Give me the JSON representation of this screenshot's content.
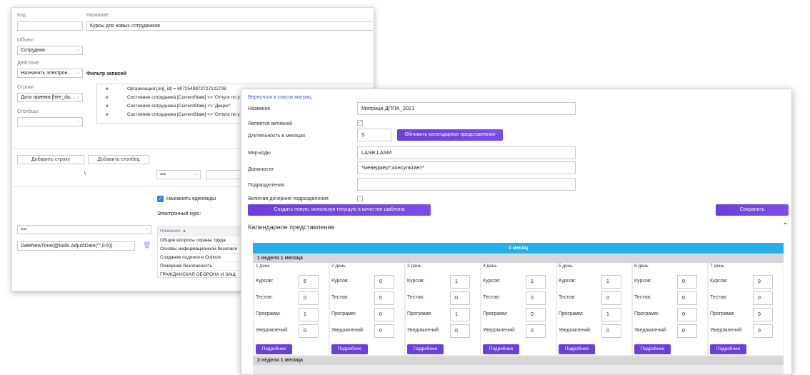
{
  "back": {
    "code_label": "Код",
    "code_value": "",
    "name_label": "Название",
    "name_value": "Курсы для новых сотрудников",
    "object_label": "Объект",
    "object_value": "Сотрудник",
    "action_label": "Действие",
    "action_value": "Назначить электрон...",
    "filter_label": "Фильтр записей",
    "rows_label": "Строки",
    "rows_value": "Дата приема [hire_da...",
    "columns_label": "Столбцы",
    "columns_value": "",
    "filters": [
      {
        "op": "и",
        "cond": "Организация [org_id]  =  6072549872727122738"
      },
      {
        "op": "и",
        "cond": "Состояние сотрудника [CurrentState]  <>  'Отпуск по у"
      },
      {
        "op": "и",
        "cond": "Состояние сотрудника [CurrentState]  <>  'Декрет'"
      },
      {
        "op": "и",
        "cond": "Состояние сотрудника [CurrentState]  <>  'Отпуск по у"
      }
    ],
    "add_row_label": "Добавить строку",
    "add_column_label": "Добавить столбец",
    "backslash": "\\",
    "eq_value": "==",
    "assign_once_label": "Назначить единожды",
    "ecourse_label": "Электронный курс:",
    "gte_value": ">=",
    "formula_value": "DateNewTime(@tools.AdjustDate(\"\",0-5))",
    "course_header": "Название ▲",
    "courses": [
      "Общие вопросы охраны труда",
      "Основы информационной безопасн",
      "Создание подписи в Outlook",
      "Пожарная безопасность",
      "ГРАЖДАНСКАЯ ОБОРОНА И ЗАЩ"
    ]
  },
  "front": {
    "back_link": "Вернуться в список матриц",
    "name_label": "Название",
    "name_value": "Матрица ДППА_2021",
    "active_label": "Является активной",
    "active_checked": true,
    "duration_label": "Длительность в месяцах",
    "duration_value": "5",
    "update_btn": "Обновить календарное представление",
    "mir_label": "Мир-коды",
    "mir_value": "LASR,LASM",
    "positions_label": "Должности",
    "positions_value": "*менеджер*;консультант*",
    "divisions_label": "Подразделения",
    "divisions_value": "",
    "include_children_label": "Включая дочерние подразделения",
    "include_children_checked": false,
    "create_template_btn": "Создать новую, используя текущую в качестве шаблона",
    "save_btn": "Сохранить",
    "calendar_title": "Календарное представление",
    "month_label": "1 месяц",
    "week1_label": "1 неделя 1 месяца",
    "week2_label": "2 неделя 1 месяца",
    "row_labels": {
      "courses": "Курсов:",
      "tests": "Тестов:",
      "programs": "Программ:",
      "notifications": "Уведомлений:"
    },
    "more_label": "Подробнее",
    "days": [
      {
        "name": "1 день",
        "courses": "6",
        "tests": "0",
        "programs": "1",
        "notifications": "0"
      },
      {
        "name": "2 день",
        "courses": "0",
        "tests": "0",
        "programs": "0",
        "notifications": "0"
      },
      {
        "name": "3 день",
        "courses": "1",
        "tests": "0",
        "programs": "1",
        "notifications": "0"
      },
      {
        "name": "4 день",
        "courses": "1",
        "tests": "0",
        "programs": "0",
        "notifications": "0"
      },
      {
        "name": "5 день",
        "courses": "1",
        "tests": "0",
        "programs": "1",
        "notifications": "0"
      },
      {
        "name": "6 день",
        "courses": "0",
        "tests": "0",
        "programs": "0",
        "notifications": "0"
      },
      {
        "name": "7 день",
        "courses": "0",
        "tests": "0",
        "programs": "0",
        "notifications": "0"
      }
    ]
  }
}
